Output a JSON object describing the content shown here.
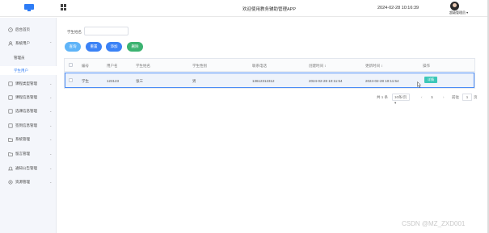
{
  "header": {
    "app_title": "欢迎使用教务辅助管理APP",
    "datetime": "2024-02-28 10:16:39",
    "username": "超级管理员 ▾",
    "accent": "#2d7cf6"
  },
  "sidebar": {
    "items": [
      {
        "label": "后台首页",
        "icon": "clock-icon"
      },
      {
        "label": "系统用户",
        "icon": "user-icon",
        "expanded": true
      },
      {
        "label": "课程类型管理",
        "icon": "book-icon"
      },
      {
        "label": "课程信息管理",
        "icon": "book-icon"
      },
      {
        "label": "选课信息管理",
        "icon": "book-icon"
      },
      {
        "label": "签到信息管理",
        "icon": "book-icon"
      },
      {
        "label": "系统管理",
        "icon": "folder-icon"
      },
      {
        "label": "留言管理",
        "icon": "folder-icon"
      },
      {
        "label": "通知公告管理",
        "icon": "bell-icon"
      },
      {
        "label": "资源管理",
        "icon": "settings-icon"
      }
    ],
    "sub_items": [
      {
        "label": "管理员"
      },
      {
        "label": "学生用户",
        "active": true
      }
    ]
  },
  "search": {
    "label": "学生姓名",
    "value": "",
    "placeholder": ""
  },
  "buttons": {
    "query": "查询",
    "reset": "重置",
    "add": "添加",
    "delete": "删除"
  },
  "table": {
    "columns": [
      "编号",
      "用户名",
      "学生姓名",
      "学生性别",
      "联系电话",
      "创建时间 ↕",
      "更新时间 ↕",
      "操作"
    ],
    "rows": [
      {
        "id": "学生",
        "username": "123123",
        "name": "张三",
        "gender": "男",
        "phone": "13612312312",
        "created": "2024-02-28 10:11:54",
        "updated": "2024-02-28 10:11:54",
        "action": "详情"
      }
    ]
  },
  "pagination": {
    "total": "共 1 条",
    "page_size": "10条/页 ▾",
    "prev": "‹",
    "current": "1",
    "next": "›",
    "goto_label": "前往",
    "goto_value": "1",
    "page_suffix": "页"
  },
  "watermark": "CSDN @MZ_ZXD001"
}
